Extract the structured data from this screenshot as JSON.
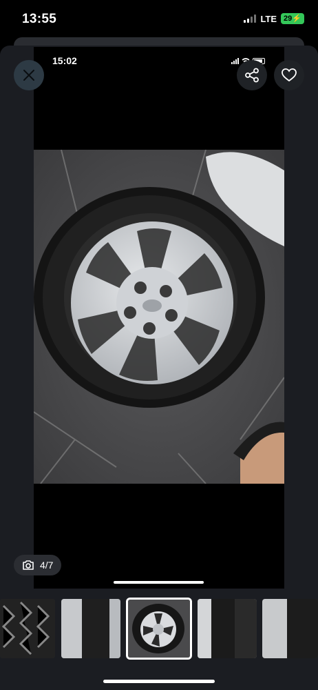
{
  "status_bar": {
    "time": "13:55",
    "network": "LTE",
    "battery": "29"
  },
  "inner_status": {
    "time": "15:02"
  },
  "viewer": {
    "counter": "4/7",
    "counter_icon": "camera-icon",
    "close_icon": "close-icon",
    "share_icon": "share-icon",
    "favorite_icon": "heart-icon"
  },
  "thumbnails": {
    "count": 5,
    "active_index": 2
  },
  "colors": {
    "battery": "#34c759",
    "close_button": "#2d3a44",
    "sheet": "#1b1d22"
  }
}
